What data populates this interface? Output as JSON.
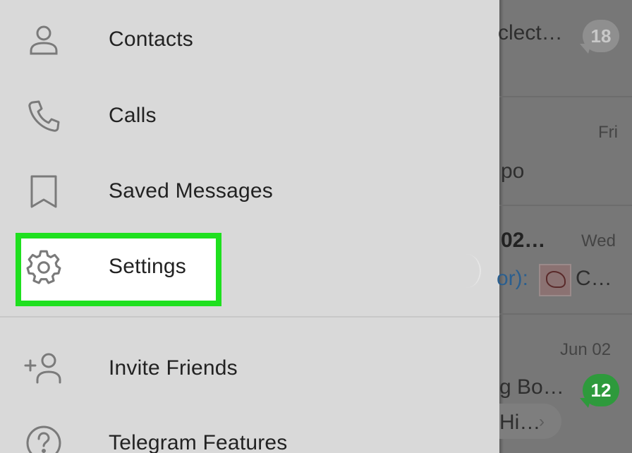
{
  "drawer": {
    "items": [
      {
        "label": "Contacts",
        "icon": "person-icon"
      },
      {
        "label": "Calls",
        "icon": "phone-icon"
      },
      {
        "label": "Saved Messages",
        "icon": "bookmark-icon"
      },
      {
        "label": "Settings",
        "icon": "gear-icon"
      },
      {
        "label": "Invite Friends",
        "icon": "add-person-icon"
      },
      {
        "label": "Telegram Features",
        "icon": "question-icon"
      }
    ],
    "highlight_color": "#1fe01f",
    "icon_color": "#7a7a7a"
  },
  "chats": [
    {
      "text": "clect…",
      "badge": "18"
    },
    {
      "date": "Fri",
      "text": "po"
    },
    {
      "title": "02…",
      "date": "Wed",
      "sender": "or):",
      "text": "C…"
    },
    {
      "date": "Jun 02",
      "text": "g Bo…",
      "preview": "Hi…",
      "badge": "12"
    }
  ],
  "colors": {
    "badge_green": "#2e9a3c",
    "badge_gray": "#8f8f8f",
    "link_blue": "#2b5f8f"
  }
}
